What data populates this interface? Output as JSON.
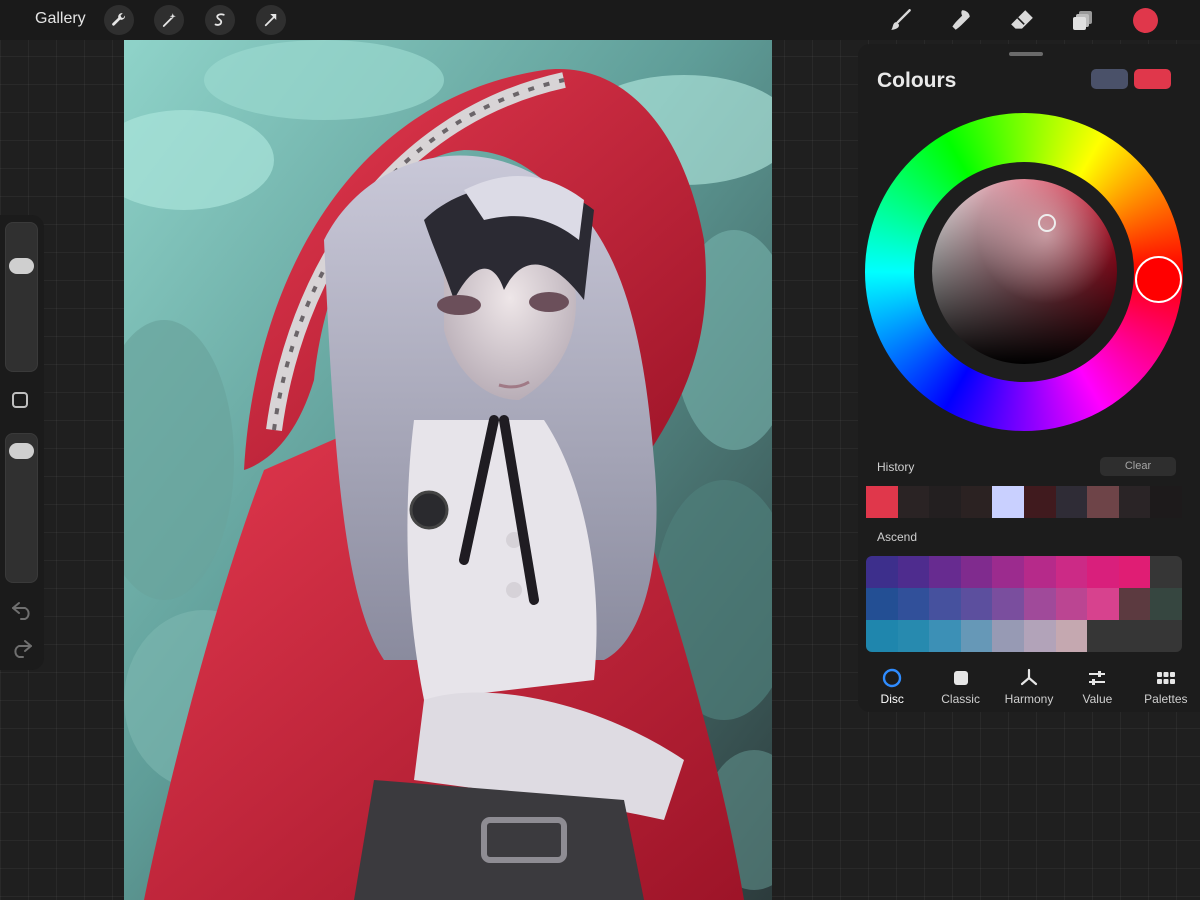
{
  "topbar": {
    "gallery_label": "Gallery",
    "left_tools": [
      "wrench-icon",
      "magic-wand-icon",
      "selection-s-icon",
      "transform-arrow-icon"
    ],
    "right_tools": [
      "brush-icon",
      "smudge-icon",
      "eraser-icon",
      "layers-icon"
    ],
    "current_color": "#e0374b"
  },
  "sidebar": {
    "brush_size_level": 0.25,
    "opacity_level": 0.05
  },
  "colours": {
    "title": "Colours",
    "previous_color": "#4a5169",
    "current_color": "#e0374b",
    "history_label": "History",
    "clear_label": "Clear",
    "history": [
      "#e0374b",
      "#2a2324",
      "#231f20",
      "#2b2222",
      "#c9d0ff",
      "#401a1e",
      "#2f2c36",
      "#6e4448",
      "#2a2426",
      "#1d1a1b"
    ],
    "palette_name": "Ascend",
    "palette": [
      "#3d2f8c",
      "#4e2c8e",
      "#672b90",
      "#802b8e",
      "#9c2b8e",
      "#b62a8a",
      "#cc2a86",
      "#d91f7c",
      "#e01d74",
      "#363636",
      "#234f94",
      "#31509a",
      "#46519e",
      "#5c4f9e",
      "#7a4e9e",
      "#a04a9a",
      "#bb4592",
      "#d7428e",
      "#5c3a40",
      "#364640",
      "#1f86ad",
      "#278aaf",
      "#3c90b6",
      "#6698b7",
      "#979ab4",
      "#b2a3b9",
      "#c5a8b0",
      "#363636",
      "#363636",
      "#363636"
    ],
    "tabs": [
      {
        "label": "Disc",
        "icon": "disc-icon"
      },
      {
        "label": "Classic",
        "icon": "classic-square-icon"
      },
      {
        "label": "Harmony",
        "icon": "harmony-icon"
      },
      {
        "label": "Value",
        "icon": "value-sliders-icon"
      },
      {
        "label": "Palettes",
        "icon": "palettes-grid-icon"
      }
    ]
  }
}
